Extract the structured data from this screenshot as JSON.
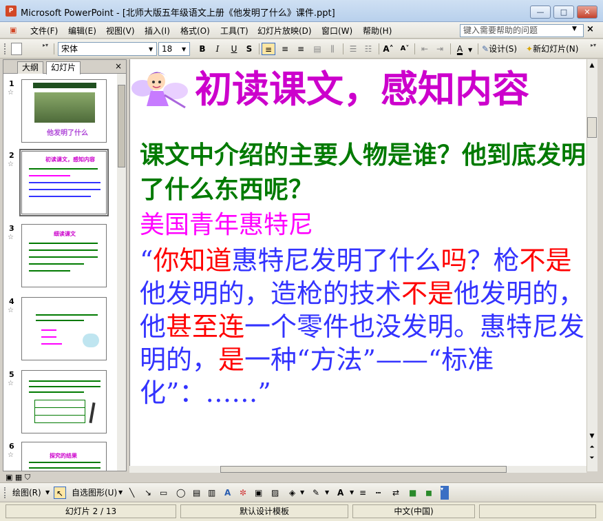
{
  "window": {
    "app_icon": "P",
    "title": "Microsoft PowerPoint - [北师大版五年级语文上册《他发明了什么》课件.ppt]",
    "minimize": "—",
    "maximize": "□",
    "close": "✕"
  },
  "menu": {
    "items": [
      "文件(F)",
      "编辑(E)",
      "视图(V)",
      "插入(I)",
      "格式(O)",
      "工具(T)",
      "幻灯片放映(D)",
      "窗口(W)",
      "帮助(H)"
    ],
    "help_placeholder": "键入需要帮助的问题",
    "doc_close": "×"
  },
  "format_toolbar": {
    "font": "宋体",
    "size": "18",
    "bold": "B",
    "italic": "I",
    "underline": "U",
    "shadow": "S",
    "align_left": "≡",
    "align_center": "≡",
    "align_right": "≡",
    "design_label": "设计(S)",
    "new_slide_label": "新幻灯片(N)"
  },
  "left_pane": {
    "tab_outline": "大纲",
    "tab_slides": "幻灯片",
    "close": "×",
    "slides": [
      {
        "num": "1",
        "caption": "他发明了什么",
        "header": "嫌疑人剪影标题"
      },
      {
        "num": "2",
        "caption": "初读课文，感知内容"
      },
      {
        "num": "3",
        "caption": "细读课文"
      },
      {
        "num": "4",
        "caption": ""
      },
      {
        "num": "5",
        "caption": ""
      },
      {
        "num": "6",
        "caption": "探究的结果"
      }
    ]
  },
  "slide": {
    "title": "初读课文，感知内容",
    "question": "课文中介绍的主要人物是谁？他到底发明了什么东西呢？",
    "answer": "美国青年惠特尼",
    "quote_segments": [
      {
        "text": "“",
        "red": false
      },
      {
        "text": "你知道",
        "red": true
      },
      {
        "text": "惠特尼发明了什么",
        "red": false
      },
      {
        "text": "吗",
        "red": true
      },
      {
        "text": "？枪",
        "red": false
      },
      {
        "text": "不是",
        "red": true
      },
      {
        "text": "他发明的，造枪的技术",
        "red": false
      },
      {
        "text": "不是",
        "red": true
      },
      {
        "text": "他发明的，他",
        "red": false
      },
      {
        "text": "甚至连",
        "red": true
      },
      {
        "text": "一个零件也没发明。惠特尼发明的，",
        "red": false
      },
      {
        "text": "是",
        "red": true
      },
      {
        "text": "一种“方法”——“标准化”：……”",
        "red": false
      }
    ]
  },
  "draw_toolbar": {
    "draw_label": "绘图(R)",
    "autoshape_label": "自选图形(U)"
  },
  "status": {
    "slide_indicator": "幻灯片 2 / 13",
    "template": "默认设计模板",
    "language": "中文(中国)"
  },
  "colors": {
    "title_magenta": "#cc00cc",
    "question_green": "#007a00",
    "answer_pink": "#ff00ff",
    "quote_blue": "#3333ff",
    "quote_red": "#ff0000"
  }
}
